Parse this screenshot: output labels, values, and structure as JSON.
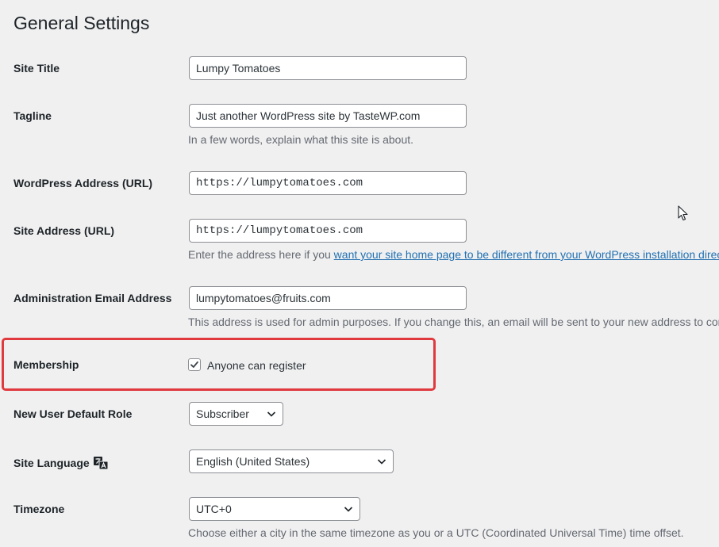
{
  "page": {
    "title": "General Settings"
  },
  "fields": {
    "site_title": {
      "label": "Site Title",
      "value": "Lumpy Tomatoes"
    },
    "tagline": {
      "label": "Tagline",
      "value": "Just another WordPress site by TasteWP.com",
      "description": "In a few words, explain what this site is about."
    },
    "wp_address": {
      "label": "WordPress Address (URL)",
      "value": "https://lumpytomatoes.com"
    },
    "site_address": {
      "label": "Site Address (URL)",
      "value": "https://lumpytomatoes.com",
      "description_prefix": "Enter the address here if you ",
      "description_link": "want your site home page to be different from your WordPress installation directory."
    },
    "admin_email": {
      "label": "Administration Email Address",
      "value": "lumpytomatoes@fruits.com",
      "description": "This address is used for admin purposes. If you change this, an email will be sent to your new address to confirm it."
    },
    "membership": {
      "label": "Membership",
      "checkbox_label": "Anyone can register",
      "checked": true
    },
    "default_role": {
      "label": "New User Default Role",
      "value": "Subscriber"
    },
    "site_language": {
      "label": "Site Language",
      "value": "English (United States)",
      "icon": "translation-icon"
    },
    "timezone": {
      "label": "Timezone",
      "value": "UTC+0",
      "description": "Choose either a city in the same timezone as you or a UTC (Coordinated Universal Time) time offset."
    }
  },
  "colors": {
    "highlight": "#e0393e",
    "link": "#2271b1",
    "background": "#f0f0f1"
  }
}
